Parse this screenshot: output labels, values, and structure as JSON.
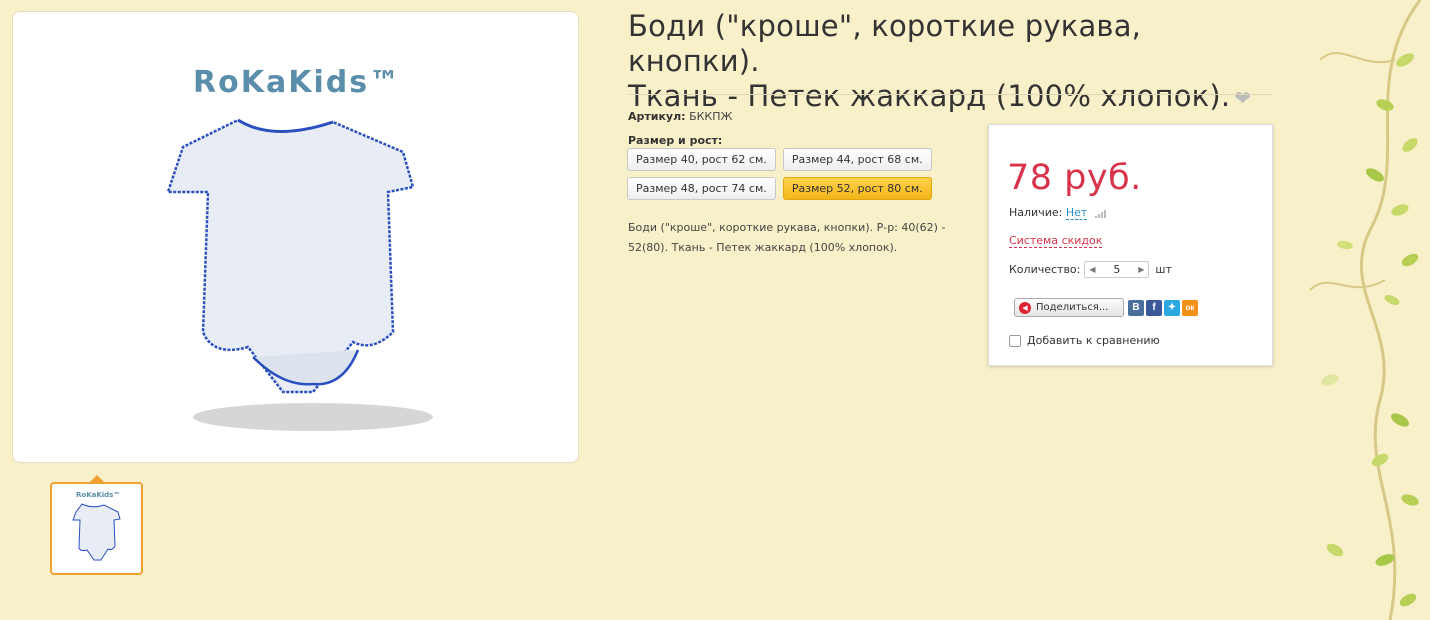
{
  "product": {
    "title_line1": "Боди (\"кроше\", короткие рукава, кнопки).",
    "title_line2": "Ткань - Петек жаккард (100% хлопок).",
    "brand_logo": "RoKaKids™",
    "article_label": "Артикул:",
    "article_value": "БККПЖ",
    "size_label": "Размер и рост:",
    "sizes": [
      {
        "label": "Размер 40, рост 62 см."
      },
      {
        "label": "Размер 44, рост 68 см."
      },
      {
        "label": "Размер 48, рост 74 см."
      },
      {
        "label": "Размер 52, рост 80 см.",
        "selected": true
      }
    ],
    "description_line1": "Боди (\"кроше\", короткие рукава, кнопки). Р-р: 40(62) -",
    "description_line2": "52(80). Ткань - Петек жаккард (100% хлопок)."
  },
  "buybox": {
    "price": "78 руб.",
    "availability_label": "Наличие:",
    "availability_value": "Нет",
    "discount_link": "Система скидок",
    "quantity_label": "Количество:",
    "quantity_value": "5",
    "quantity_unit": "шт",
    "share_label": "Поделиться...",
    "social_vk": "В",
    "social_fb": "f",
    "social_ok": "ок",
    "compare_label": "Добавить к сравнению"
  },
  "icons": {
    "favorite": "heart-icon",
    "signal": "signal-bars-icon",
    "share": "megaphone-icon",
    "twitter": "twitter-bird-icon"
  },
  "colors": {
    "background": "#f8f0c8",
    "price": "#d8334a",
    "link": "#2a8bcb",
    "selected_size": "#f3b619",
    "thumb_border": "#f0a030"
  }
}
